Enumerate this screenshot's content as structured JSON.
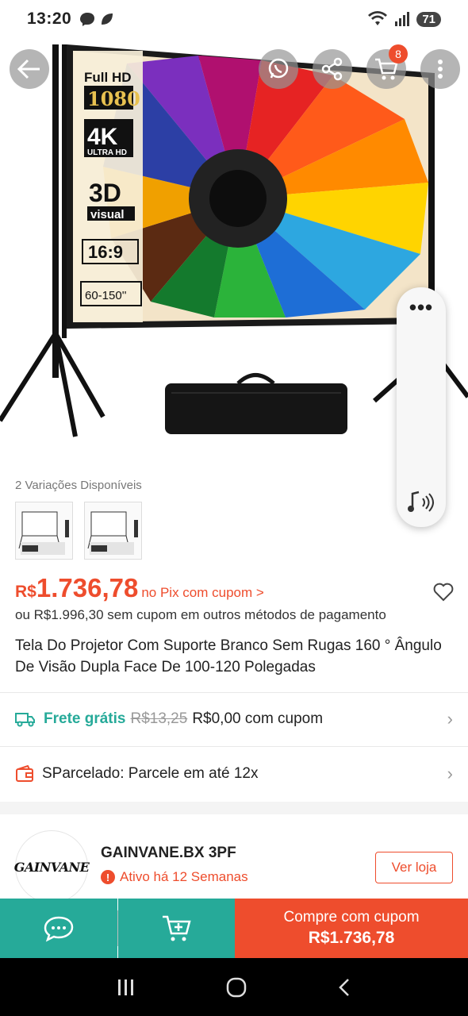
{
  "status_bar": {
    "time": "13:20",
    "battery": "71"
  },
  "product_image": {
    "screen_labels": [
      "Full HD",
      "1080",
      "4K",
      "ULTRA HD",
      "3D",
      "visual",
      "16:9",
      "60-150''"
    ]
  },
  "top_actions": {
    "cart_count": "8"
  },
  "variations": {
    "label": "2 Variações Disponíveis"
  },
  "price": {
    "currency": "R$",
    "value": "1.736,78",
    "note": "no Pix com cupom >",
    "alt": "ou R$1.996,30 sem cupom em outros métodos de pagamento"
  },
  "title": "Tela Do Projetor Com Suporte Branco Sem Rugas 160 ° Ângulo De Visão Dupla Face De 100-120 Polegadas",
  "shipping": {
    "label": "Frete grátis",
    "old_price": "R$13,25",
    "new_price": "R$0,00 com cupom"
  },
  "installments": {
    "label": "SParcelado: Parcele em até 12x"
  },
  "seller": {
    "logo_text": "GAINVANE",
    "name": "GAINVANE.BX 3PF",
    "status": "Ativo há 12 Semanas",
    "visit_label": "Ver loja"
  },
  "bottom_bar": {
    "buy_label": "Compre com cupom",
    "buy_price": "R$1.736,78"
  },
  "colors": {
    "accent": "#ee4d2d",
    "teal": "#26aa99"
  }
}
